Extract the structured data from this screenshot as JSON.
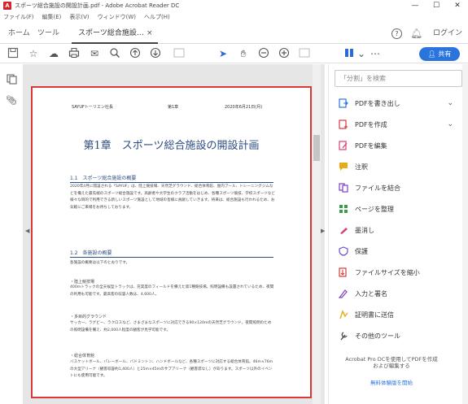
{
  "window": {
    "title": "スポーツ総合施設の開設計画.pdf - Adobe Acrobat Reader DC",
    "minimize": "—",
    "maximize": "☐",
    "close": "✕"
  },
  "menubar": {
    "items": [
      "ファイル(F)",
      "編集(E)",
      "表示(V)",
      "ウィンドウ(W)",
      "ヘルプ(H)"
    ]
  },
  "tabs": {
    "home": "ホーム",
    "tools": "ツール",
    "document": "スポーツ総合施設…",
    "close_glyph": "×"
  },
  "header_right": {
    "help": "?",
    "login": "ログイン"
  },
  "toolbar": {
    "share_label": "共有"
  },
  "document": {
    "header_left": "SAYUFトーリエン社長",
    "header_mid": "第1章",
    "header_right": "2020年6月21日(月)",
    "chapter_title": "第1章　スポーツ総合施設の開設計画",
    "section1_title": "1.1　スポーツ総合施設の概要",
    "section1_body": "2020年4月に開設される「SAYUF」は、陸上競技場、天然芝グラウンド、総合体育館、屋内プール、トレーニングジムなどを備えた最先端のスポーツ総合施設です。高齢者や大学生のクラブ活動をはじめ、各種スポーツ競技、学校スポーツなど様々な目的で利用できる新しいスポーツ施設として地域の皆様に貢献していきます。将来は、総合施設も行われるため、お気軽にご来場をお待ちしております。",
    "section2_title": "1.2　各施設の概要",
    "section2_intro": "各施設の概要は以下のとおりです。",
    "item1_head": "・陸上競技場",
    "item1_body": "400mトラックの全天候型トラックは、充実度のフィールドを備えた第1種競技場。照明設備も設置されているため、夜間の利用も可能です。最高客の収容人数は、4,600人。",
    "item2_head": "・多目的グラウンド",
    "item2_body": "サッカー、ラグビー、ラクロスなど、さまざまなスポーツに対応できる90×120mの天然芝グラウンド。夜間照明のための照明設備を備え、約2,000人程度の観客が見学可能です。",
    "item3_head": "・総合体育館",
    "item3_body": "バスケットボール、バレーボール、バドミントン、ハンドボールなど、各種スポーツに対応する総合体育館。46m×76mの大型アリーナ（観客収容約1,400人）と25m×45mのサブアリーナ（観客席なし）があります。スポーツ以外のイベントにも使用可能です。"
  },
  "right_panel": {
    "search_placeholder": "「分割」を検索",
    "tools": [
      {
        "label": "PDFを書き出し",
        "color": "#2b74de"
      },
      {
        "label": "PDFを作成",
        "color": "#d83a3a"
      },
      {
        "label": "PDFを編集",
        "color": "#d4407a"
      },
      {
        "label": "注釈",
        "color": "#e8a91b"
      },
      {
        "label": "ファイルを結合",
        "color": "#7b3fc4"
      },
      {
        "label": "ページを整理",
        "color": "#3b9d4b"
      },
      {
        "label": "墨消し",
        "color": "#d4407a"
      },
      {
        "label": "保護",
        "color": "#6c4fd0"
      },
      {
        "label": "ファイルサイズを縮小",
        "color": "#d83a3a"
      },
      {
        "label": "入力と署名",
        "color": "#7b3fc4"
      },
      {
        "label": "証明書に送信",
        "color": "#e8a91b"
      },
      {
        "label": "その他のツール",
        "color": "#555555"
      }
    ],
    "promo_text": "Acrobat Pro DCを使用してPDFを作成および編集する",
    "promo_link": "無料体験版を開始"
  }
}
